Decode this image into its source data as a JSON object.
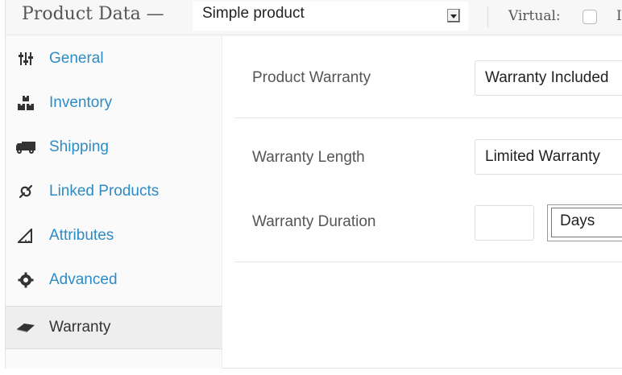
{
  "header": {
    "title": "Product Data —",
    "product_type": "Simple product",
    "virtual_label": "Virtual:",
    "clipped_next": "I"
  },
  "sidebar": {
    "items": [
      {
        "label": "General",
        "icon": "sliders-icon"
      },
      {
        "label": "Inventory",
        "icon": "boxes-icon"
      },
      {
        "label": "Shipping",
        "icon": "truck-icon"
      },
      {
        "label": "Linked Products",
        "icon": "link-icon"
      },
      {
        "label": "Attributes",
        "icon": "triangle-ruler-icon"
      },
      {
        "label": "Advanced",
        "icon": "gear-icon"
      },
      {
        "label": "Warranty",
        "icon": "eraser-icon",
        "active": true
      }
    ]
  },
  "panel": {
    "warranty_label": "Product Warranty",
    "warranty_value": "Warranty Included",
    "length_label": "Warranty Length",
    "length_value": "Limited Warranty",
    "duration_label": "Warranty Duration",
    "duration_value": "",
    "duration_unit": "Days"
  },
  "colors": {
    "link": "#2e8cc4",
    "header_bg": "#f7f7f7",
    "sidebar_bg": "#fafafa",
    "active_bg": "#eeeeee"
  }
}
